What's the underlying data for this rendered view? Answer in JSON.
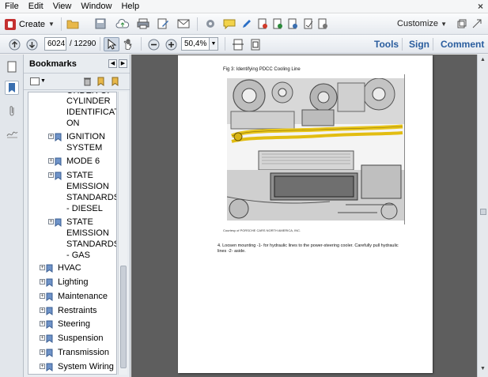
{
  "menu": [
    "File",
    "Edit",
    "View",
    "Window",
    "Help"
  ],
  "toolbar": {
    "create_label": "Create",
    "customize_label": "Customize",
    "page_current": "6024",
    "page_total": "/ 12290",
    "zoom": "50,4%",
    "links": [
      "Tools",
      "Sign",
      "Comment"
    ]
  },
  "bookmarks": {
    "title": "Bookmarks",
    "items": [
      {
        "label": "CYLINDER IDENTIFICATI ON",
        "lines": [
          "CYLINDER",
          "IDENTIFICATI",
          "ON"
        ],
        "level": 2
      },
      {
        "label": "IGNITION SYSTEM",
        "lines": [
          "IGNITION",
          "SYSTEM"
        ],
        "level": 2
      },
      {
        "label": "MODE 6",
        "lines": [
          "MODE 6"
        ],
        "level": 2
      },
      {
        "label": "STATE EMISSION STANDARDS - DIESEL",
        "lines": [
          "STATE",
          "EMISSION",
          "STANDARDS",
          "- DIESEL"
        ],
        "level": 2
      },
      {
        "label": "STATE EMISSION STANDARDS - GAS",
        "lines": [
          "STATE",
          "EMISSION",
          "STANDARDS",
          "- GAS"
        ],
        "level": 2
      },
      {
        "label": "HVAC",
        "lines": [
          "HVAC"
        ],
        "level": 1
      },
      {
        "label": "Lighting",
        "lines": [
          "Lighting"
        ],
        "level": 1
      },
      {
        "label": "Maintenance",
        "lines": [
          "Maintenance"
        ],
        "level": 1
      },
      {
        "label": "Restraints",
        "lines": [
          "Restraints"
        ],
        "level": 1
      },
      {
        "label": "Steering",
        "lines": [
          "Steering"
        ],
        "level": 1
      },
      {
        "label": "Suspension",
        "lines": [
          "Suspension"
        ],
        "level": 1
      },
      {
        "label": "Transmission",
        "lines": [
          "Transmission"
        ],
        "level": 1
      },
      {
        "label": "System Wiring",
        "lines": [
          "System Wiring"
        ],
        "level": 1
      }
    ]
  },
  "document": {
    "figure_title": "Fig 3: Identifying PDCC Cooling Line",
    "courtesy": "Courtesy of PORSCHE CARS NORTH AMERICA, INC.",
    "step": "4. Loosen mounting -1- for hydraulic lines to the power-steering cooler. Carefully pull hydraulic lines -2- aside."
  },
  "colors": {
    "accent_link": "#2a5d9e",
    "highlight_line": "#e8c51a",
    "doc_background": "#5e5e5e"
  }
}
